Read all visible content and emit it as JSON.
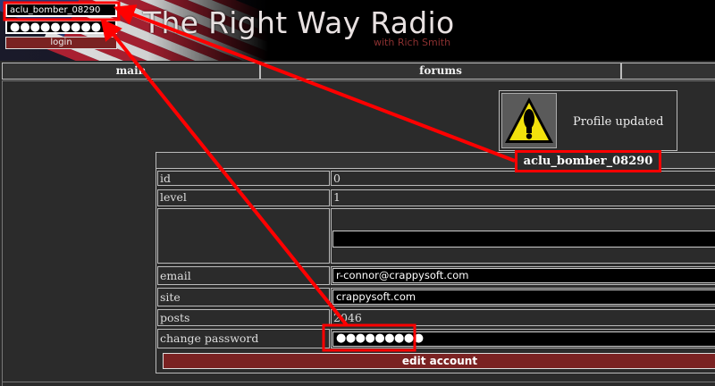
{
  "header": {
    "title": "The Right Way Radio",
    "subtitle": "with Rich Smith"
  },
  "login": {
    "username": "aclu_bomber_08290",
    "password_mask": "●●●●●●●●●",
    "button_label": "login"
  },
  "nav": {
    "items": [
      {
        "label": "main"
      },
      {
        "label": "forums"
      },
      {
        "label": ""
      }
    ]
  },
  "notice": {
    "icon": "warning-icon",
    "text": "Profile updated"
  },
  "profile": {
    "username_header": "aclu_bomber_08290",
    "rows": {
      "id": {
        "label": "id",
        "value": "0"
      },
      "level": {
        "label": "level",
        "value": "1"
      },
      "email": {
        "label": "email",
        "value": "r-connor@crappysoft.com"
      },
      "site": {
        "label": "site",
        "value": "crappysoft.com"
      },
      "posts": {
        "label": "posts",
        "value": "2046"
      },
      "change_password": {
        "label": "change password",
        "value_mask": "●●●●●●●●●"
      }
    },
    "edit_button_label": "edit account"
  },
  "annotation": {
    "callout_text": "aclu_bomber_08290",
    "color": "#ff0000"
  }
}
